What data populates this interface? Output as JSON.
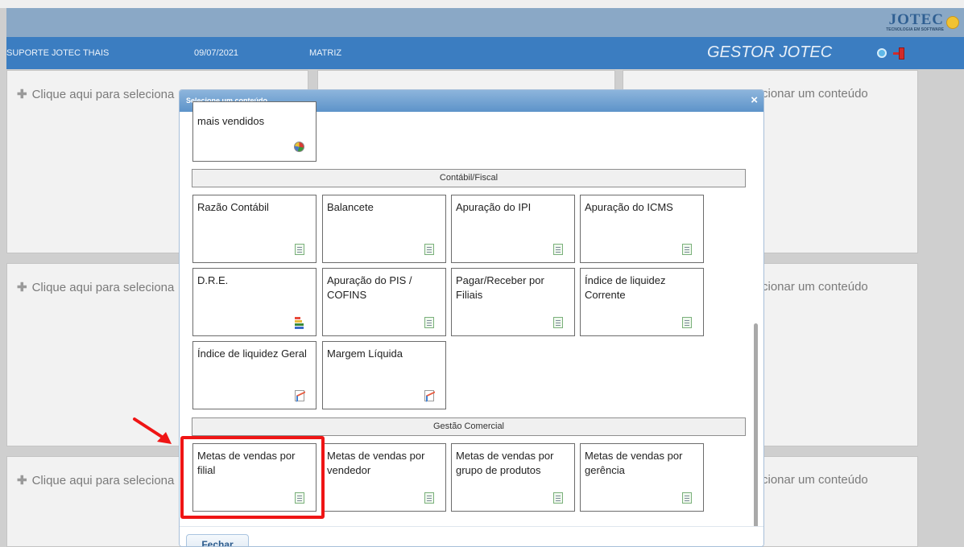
{
  "brand": {
    "logo_text": "JOTEC",
    "logo_sub": "TECNOLOGIA EM SOFTWARE"
  },
  "infobar": {
    "user": "SUPORTE JOTEC  THAIS",
    "date": "09/07/2021",
    "branch": "MATRIZ",
    "app_title": "GESTOR JOTEC",
    "icons": [
      "refresh-icon",
      "exit-icon"
    ]
  },
  "panels": {
    "left_label": "Clique aqui para seleciona",
    "right_label": "cionar um conteúdo"
  },
  "dialog": {
    "title": "Selecione um conteúdo",
    "close_glyph": "×",
    "close_button_label": "Fechar",
    "partial_tile": {
      "label": "mais vendidos",
      "icon": "pie-chart-icon"
    },
    "sections": [
      {
        "title": "Contábil/Fiscal",
        "tiles": [
          {
            "label": "Razão Contábil",
            "icon": "spreadsheet-icon"
          },
          {
            "label": "Balancete",
            "icon": "spreadsheet-icon"
          },
          {
            "label": "Apuração do IPI",
            "icon": "spreadsheet-icon"
          },
          {
            "label": "Apuração do ICMS",
            "icon": "spreadsheet-icon"
          },
          {
            "label": "D.R.E.",
            "icon": "bar-chart-icon"
          },
          {
            "label": "Apuração do PIS / COFINS",
            "icon": "spreadsheet-icon"
          },
          {
            "label": "Pagar/Receber por Filiais",
            "icon": "spreadsheet-icon"
          },
          {
            "label": "Índice de liquidez Corrente",
            "icon": "spreadsheet-icon"
          },
          {
            "label": "Índice de liquidez Geral",
            "icon": "line-chart-icon"
          },
          {
            "label": "Margem Líquida",
            "icon": "line-chart-icon"
          }
        ]
      },
      {
        "title": "Gestão Comercial",
        "tiles": [
          {
            "label": "Metas de vendas por filial",
            "icon": "spreadsheet-icon"
          },
          {
            "label": "Metas de vendas por vendedor",
            "icon": "spreadsheet-icon"
          },
          {
            "label": "Metas de vendas por grupo de produtos",
            "icon": "spreadsheet-icon"
          },
          {
            "label": "Metas de vendas por gerência",
            "icon": "spreadsheet-icon"
          }
        ]
      }
    ]
  },
  "colors": {
    "infobar": "#3b7dc1",
    "banner": "#8aa8c6",
    "dialog_header": "#6fa2d2",
    "highlight": "#ef1515"
  }
}
